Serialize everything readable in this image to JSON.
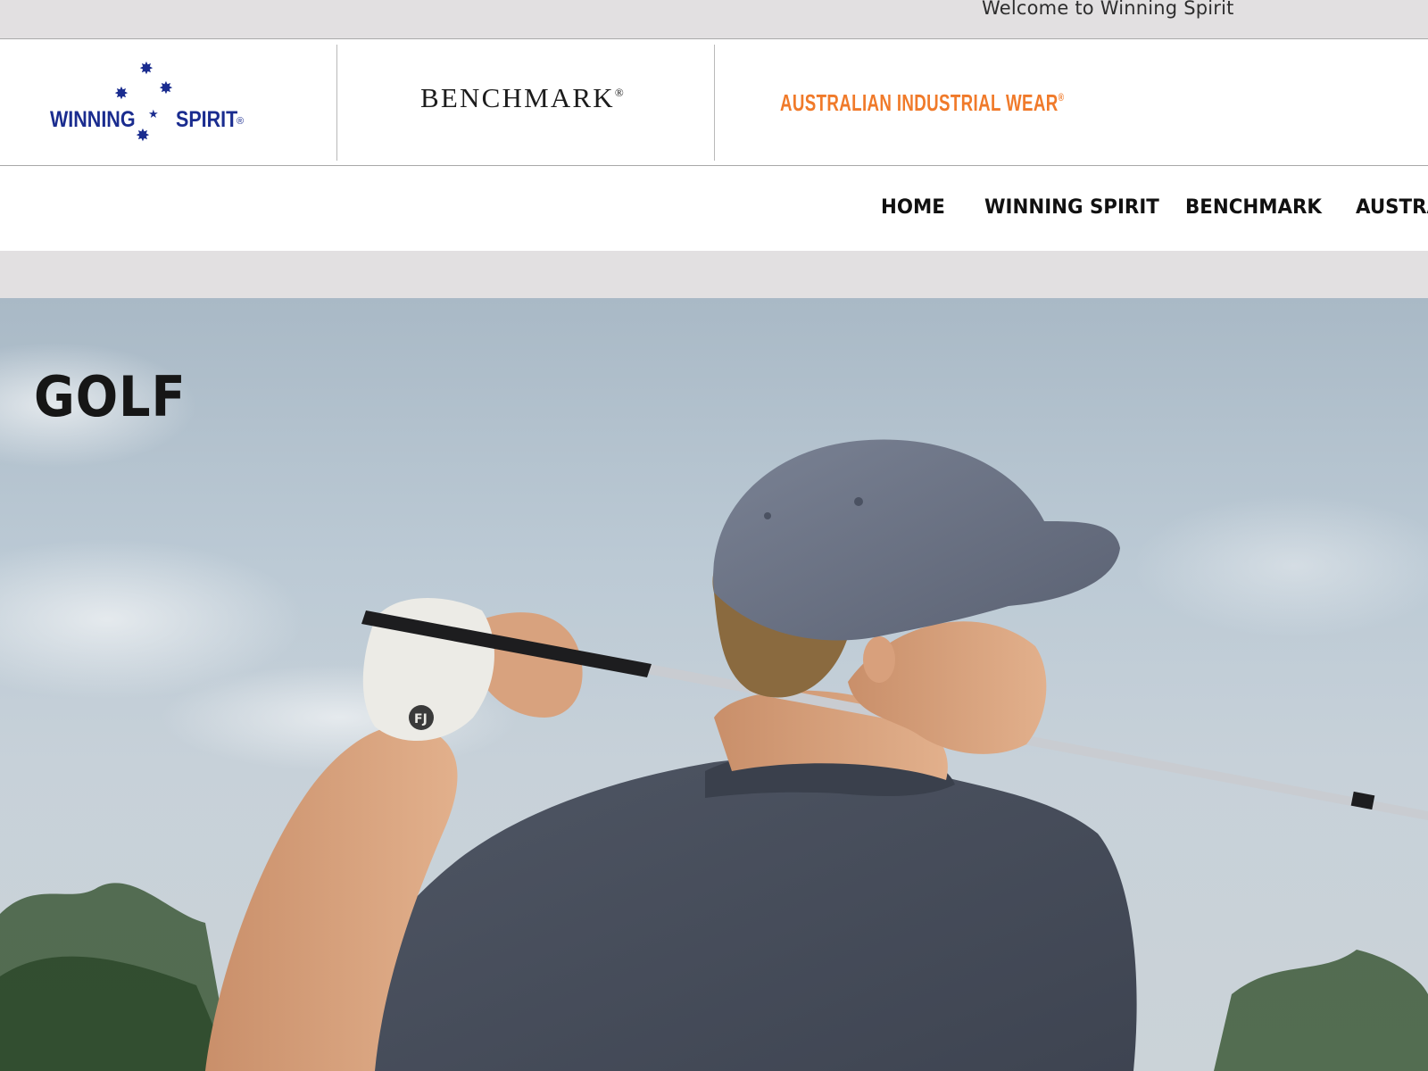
{
  "topbar": {
    "welcome_text": "Welcome to Winning Spirit"
  },
  "brands": {
    "winning_spirit": {
      "word1": "WINNING",
      "word2": "SPIRIT",
      "reg": "®"
    },
    "benchmark": {
      "name": "BENCHMARK",
      "reg": "®"
    },
    "australian_industrial_wear": {
      "name": "AUSTRALIAN INDUSTRIAL WEAR",
      "reg": "®"
    }
  },
  "nav": {
    "items": [
      {
        "label": "HOME"
      },
      {
        "label": "WINNING SPIRIT"
      },
      {
        "label": "BENCHMARK"
      },
      {
        "label": "AUSTRA"
      }
    ]
  },
  "hero": {
    "title": "GOLF"
  },
  "colors": {
    "brand_blue": "#1a2c8f",
    "aiw_orange": "#f07a2a",
    "page_grey": "#e2e0e1"
  }
}
